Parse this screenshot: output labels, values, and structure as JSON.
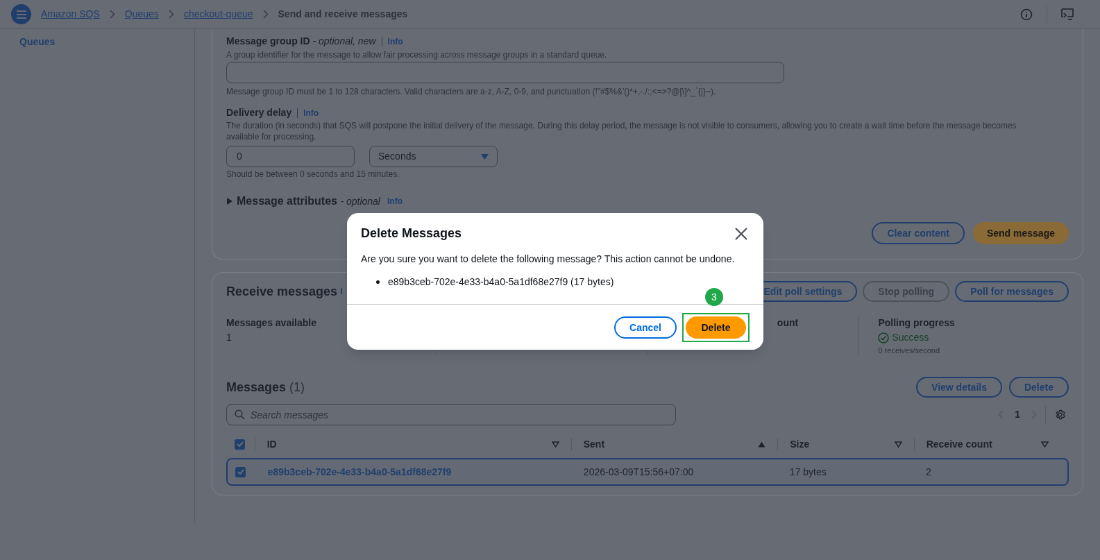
{
  "breadcrumbs": [
    {
      "label": "Amazon SQS",
      "link": true
    },
    {
      "label": "Queues",
      "link": true
    },
    {
      "label": "checkout-queue",
      "link": true
    },
    {
      "label": "Send and receive messages",
      "link": false
    }
  ],
  "sidebar": {
    "items": [
      {
        "label": "Queues"
      }
    ]
  },
  "send_panel": {
    "group_id": {
      "label": "Message group ID",
      "qualifier": "- optional, new",
      "info": "Info",
      "description": "A group identifier for the message to allow fair processing across message groups in a standard queue.",
      "constraint": "Message group ID must be 1 to 128 characters. Valid characters are a-z, A-Z, 0-9, and punctuation (!\"#$%&'()*+,-./:;<=>?@[\\]^_`{|}~)."
    },
    "delivery_delay": {
      "label": "Delivery delay",
      "info": "Info",
      "description": "The duration (in seconds) that SQS will postpone the initial delivery of the message. During this delay period, the message is not visible to consumers, allowing you to create a wait time before the message becomes available for processing.",
      "value": "0",
      "unit": "Seconds",
      "hint": "Should be between 0 seconds and 15 minutes."
    },
    "attributes": {
      "label": "Message attributes",
      "qualifier": "- optional",
      "info": "Info",
      "expanded": false
    },
    "buttons": [
      {
        "label": "Clear content",
        "kind": "secondary"
      },
      {
        "label": "Send message",
        "kind": "primary"
      }
    ]
  },
  "receive_panel": {
    "title": "Receive messages",
    "info": "I",
    "buttons": [
      {
        "label": "Edit poll settings",
        "disabled": false
      },
      {
        "label": "Stop polling",
        "disabled": true
      },
      {
        "label": "Poll for messages",
        "disabled": false
      }
    ],
    "stats": [
      {
        "label": "Messages available",
        "value": "1"
      },
      {
        "label": "ount"
      },
      {
        "label": "Polling progress",
        "status": "Success",
        "rate": "0 receives/second"
      }
    ],
    "messages": {
      "title": "Messages",
      "count": "(1)",
      "buttons": [
        {
          "label": "View details"
        },
        {
          "label": "Delete"
        }
      ],
      "search": {
        "placeholder": "Search messages"
      },
      "page": "1",
      "select_all": {
        "checked": true
      },
      "columns": [
        {
          "label": "ID",
          "sorted": false
        },
        {
          "label": "Sent",
          "sorted": true
        },
        {
          "label": "Size",
          "sorted": false
        },
        {
          "label": "Receive count",
          "sorted": false
        }
      ],
      "rows": [
        {
          "selected": true,
          "id": "e89b3ceb-702e-4e33-b4a0-5a1df68e27f9",
          "sent": "2026-03-09T15:56+07:00",
          "size": "17 bytes",
          "receive_count": "2"
        }
      ]
    }
  },
  "modal": {
    "title": "Delete Messages",
    "body": "Are you sure you want to delete the following message? This action cannot be undone.",
    "items": [
      "e89b3ceb-702e-4e33-b4a0-5a1df68e27f9 (17 bytes)"
    ],
    "buttons": [
      {
        "label": "Cancel",
        "kind": "secondary"
      },
      {
        "label": "Delete",
        "kind": "primary"
      }
    ],
    "annotation": {
      "label": "3"
    }
  }
}
